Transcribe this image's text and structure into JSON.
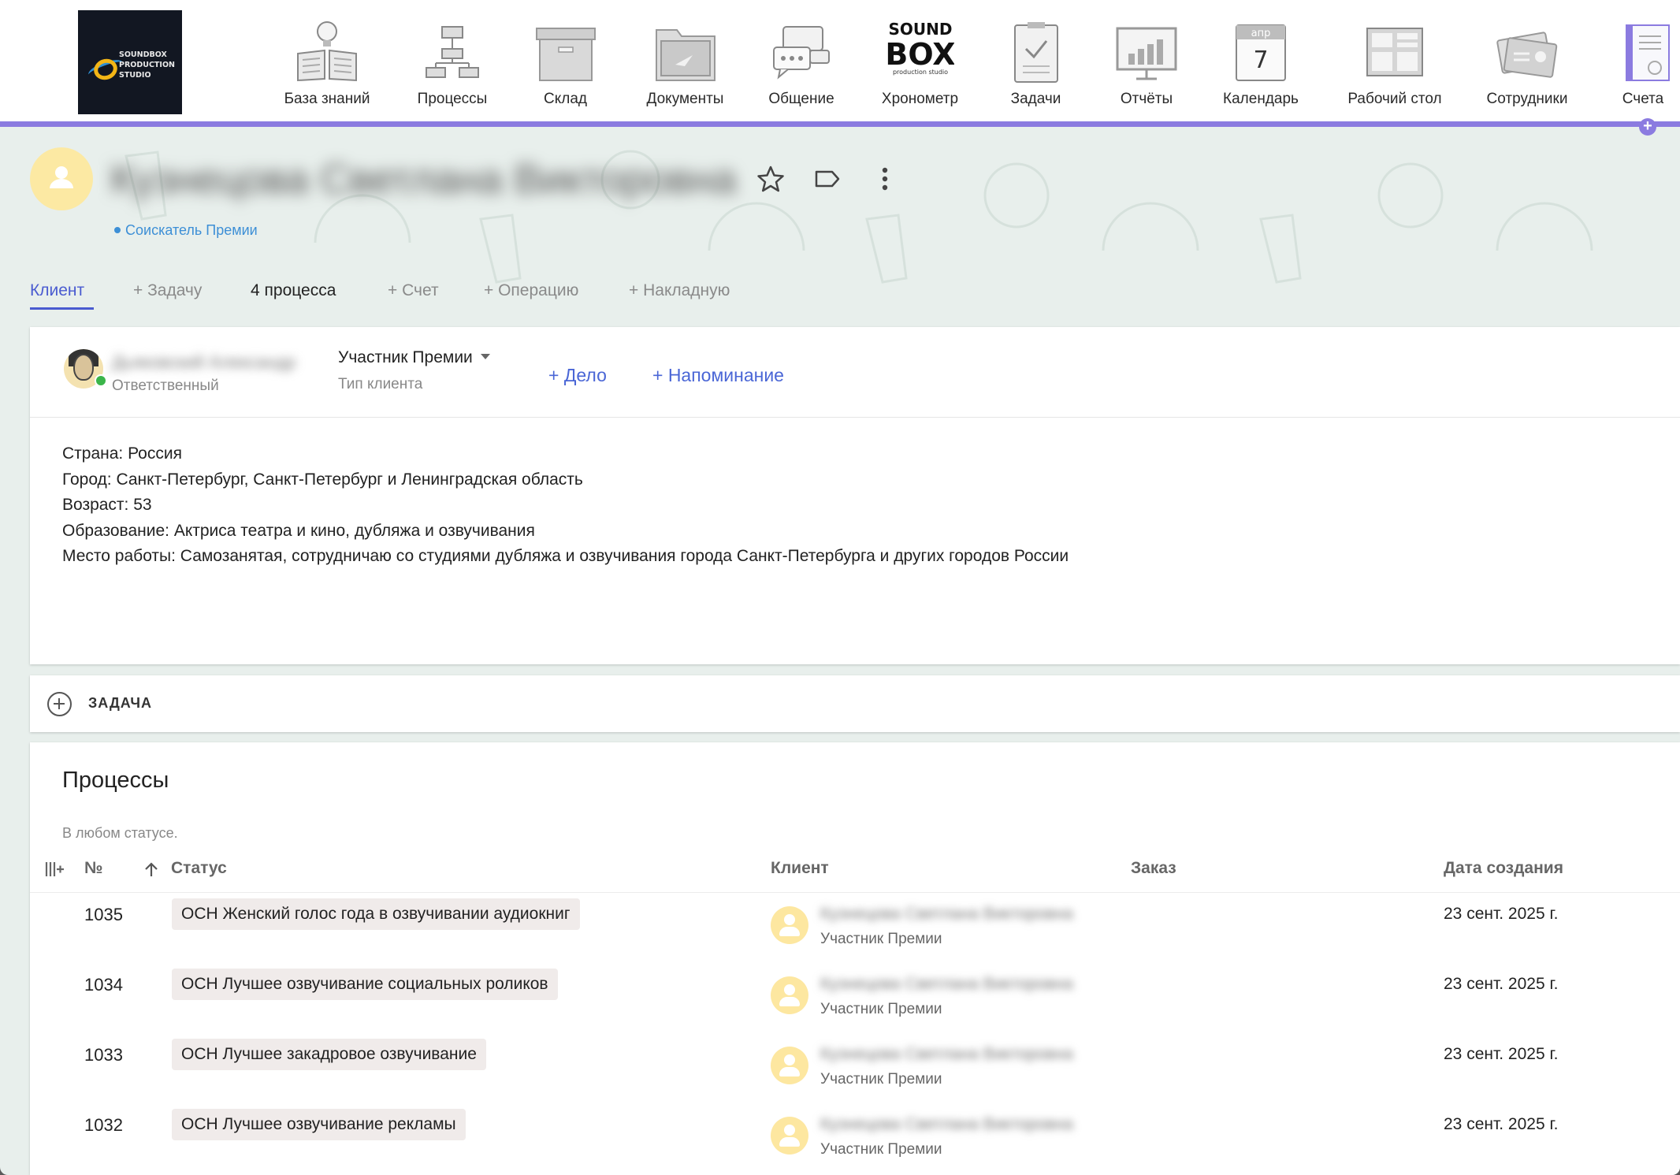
{
  "brand": {
    "logo_alt": "SOUNDBOX PRODUCTION STUDIO",
    "logo_lines": [
      "SOUNDBOX",
      "PRODUCTION",
      "STUDIO"
    ]
  },
  "nav": {
    "items": [
      {
        "label": "База знаний",
        "icon": "book-bulb-icon"
      },
      {
        "label": "Процессы",
        "icon": "flowchart-icon"
      },
      {
        "label": "Склад",
        "icon": "storage-box-icon"
      },
      {
        "label": "Документы",
        "icon": "folder-icon"
      },
      {
        "label": "Общение",
        "icon": "chat-bubbles-icon"
      },
      {
        "label": "Хронометр",
        "icon": "soundbox-logo-icon"
      },
      {
        "label": "Задачи",
        "icon": "clipboard-check-icon"
      },
      {
        "label": "Отчёты",
        "icon": "bar-chart-board-icon"
      },
      {
        "label": "Календарь",
        "icon": "calendar-icon"
      },
      {
        "label": "Рабочий стол",
        "icon": "dashboard-icon"
      },
      {
        "label": "Сотрудники",
        "icon": "id-cards-icon"
      },
      {
        "label": "Счета",
        "icon": "invoice-icon"
      }
    ],
    "calendar_month": "апр",
    "calendar_day": "7",
    "soundbox_top": "SOUND",
    "soundbox_mid": "BOX",
    "soundbox_sub": "production studio",
    "accent_color": "#8b7be0"
  },
  "client": {
    "name": "Кузнецова Светлана Викторовна",
    "status": "Соискатель Премии"
  },
  "tabs": [
    "Клиент",
    "+ Задачу",
    "4 процесса",
    "+ Счет",
    "+ Операцию",
    "+ Накладную"
  ],
  "details": {
    "responsible_name": "Дьяковский Александр",
    "responsible_label": "Ответственный",
    "client_type_value": "Участник Премии",
    "client_type_label": "Тип клиента",
    "add_deal": "+ Дело",
    "add_reminder": "+ Напоминание",
    "info_lines": [
      "Страна: Россия",
      "Город: Санкт-Петербург, Санкт-Петербург и Ленинградская область",
      "Возраст: 53",
      "Образование: Актриса театра и кино, дубляжа и озвучивания",
      "Место работы: Самозанятая, сотрудничаю со студиями дубляжа и озвучивания города Санкт-Петербурга и других городов России"
    ]
  },
  "task_section": {
    "label": "ЗАДАЧА"
  },
  "processes": {
    "title": "Процессы",
    "filter": "В любом статусе.",
    "columns": {
      "num": "№",
      "status": "Статус",
      "client": "Клиент",
      "order": "Заказ",
      "created": "Дата создания"
    },
    "rows": [
      {
        "num": "1035",
        "status": "ОСН Женский голос года в озвучивании аудиокниг",
        "client": "Кузнецова Светлана Викторовна",
        "client_type": "Участник Премии",
        "order": "",
        "created": "23 сент. 2025 г."
      },
      {
        "num": "1034",
        "status": "ОСН Лучшее озвучивание социальных роликов",
        "client": "Кузнецова Светлана Викторовна",
        "client_type": "Участник Премии",
        "order": "",
        "created": "23 сент. 2025 г."
      },
      {
        "num": "1033",
        "status": "ОСН Лучшее закадровое озвучивание",
        "client": "Кузнецова Светлана Викторовна",
        "client_type": "Участник Премии",
        "order": "",
        "created": "23 сент. 2025 г."
      },
      {
        "num": "1032",
        "status": "ОСН Лучшее озвучивание рекламы",
        "client": "Кузнецова Светлана Викторовна",
        "client_type": "Участник Премии",
        "order": "",
        "created": "23 сент. 2025 г."
      }
    ]
  }
}
